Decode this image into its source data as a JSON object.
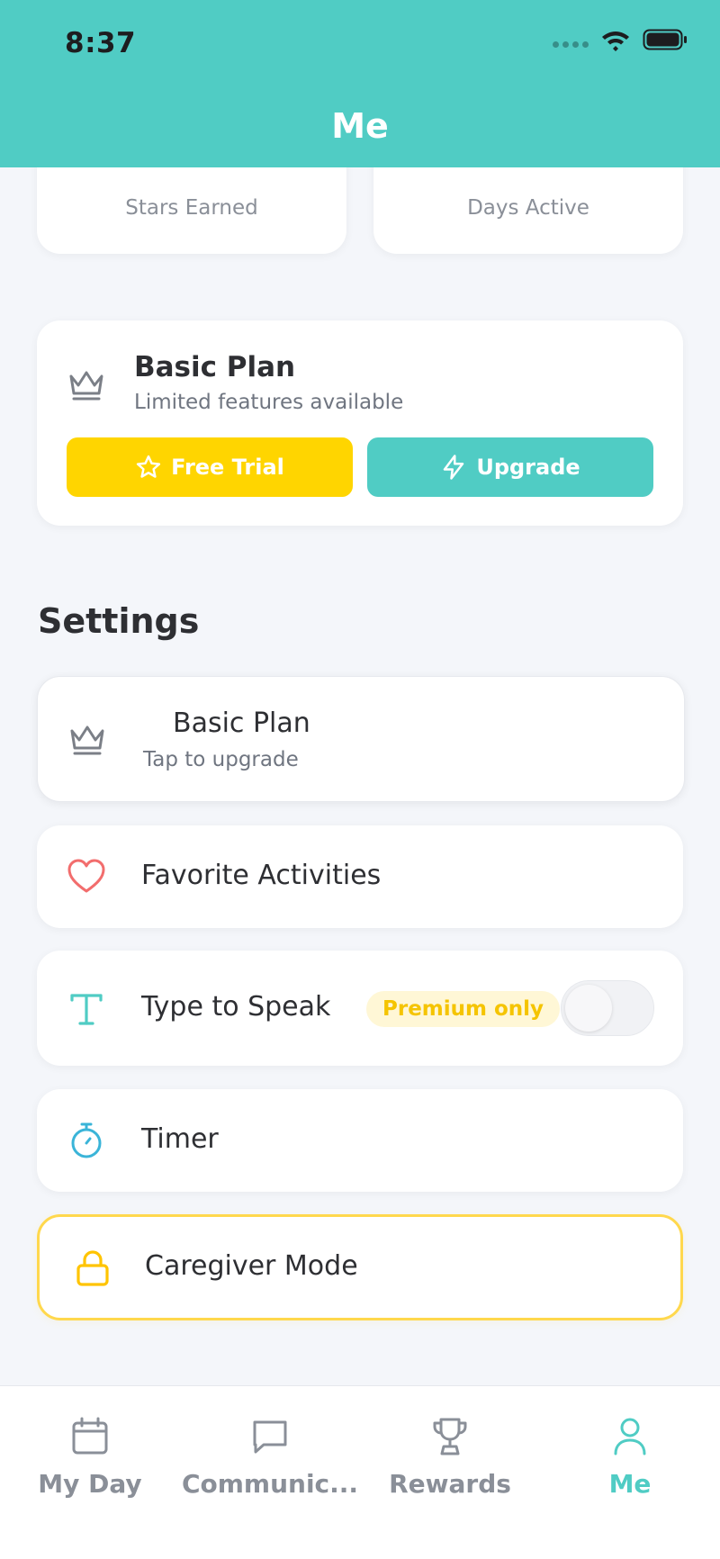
{
  "status_bar": {
    "time": "8:37"
  },
  "header": {
    "title": "Me"
  },
  "stats": [
    {
      "label": "Stars Earned"
    },
    {
      "label": "Days Active"
    }
  ],
  "plan_card": {
    "title": "Basic Plan",
    "subtitle": "Limited features available",
    "free_trial_label": "Free Trial",
    "upgrade_label": "Upgrade"
  },
  "settings": {
    "title": "Settings",
    "items": [
      {
        "title": "Basic Plan",
        "subtitle": "Tap to upgrade"
      },
      {
        "title": "Favorite Activities"
      },
      {
        "title": "Type to Speak",
        "badge": "Premium only"
      },
      {
        "title": "Timer"
      },
      {
        "title": "Caregiver Mode"
      }
    ]
  },
  "tabbar": {
    "items": [
      {
        "label": "My Day"
      },
      {
        "label": "Communic..."
      },
      {
        "label": "Rewards"
      },
      {
        "label": "Me"
      }
    ]
  },
  "colors": {
    "header": "#50CCC4",
    "accent_teal": "#50CCC4",
    "accent_yellow": "#FFD500",
    "heart_red": "#F26D6D",
    "background": "#F4F6FA"
  },
  "icons": {
    "plan": "crown-icon",
    "free_trial": "star-icon",
    "upgrade": "lightning-icon",
    "favorites": "heart-icon",
    "type_to_speak": "text-icon",
    "timer": "stopwatch-icon",
    "caregiver": "lock-icon",
    "tab_myday": "calendar-icon",
    "tab_comm": "chat-icon",
    "tab_rewards": "trophy-icon",
    "tab_me": "person-icon"
  }
}
